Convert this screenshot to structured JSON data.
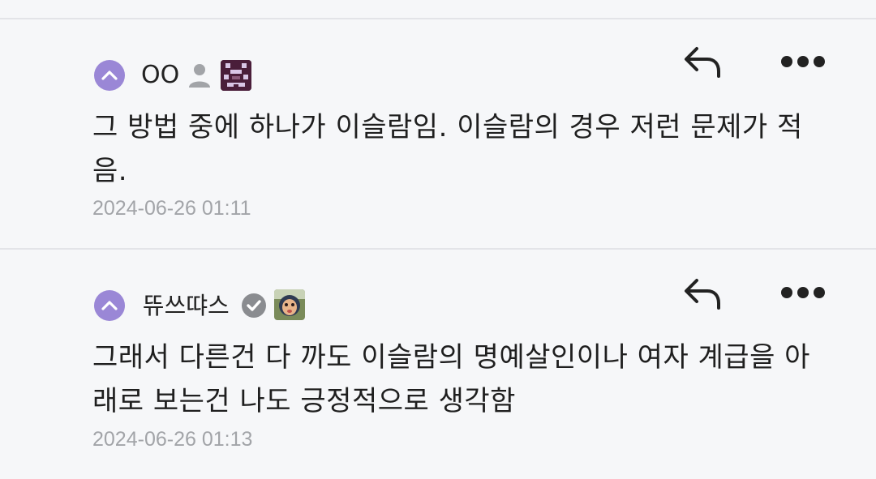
{
  "comments": [
    {
      "username": "OO",
      "body": "그 방법 중에 하나가 이슬람임. 이슬람의 경우 저런 문제가 적음.",
      "timestamp": "2024-06-26 01:11",
      "user_badge": "person-icon",
      "avatar_colors": {
        "bg": "#4a1e3a",
        "fg": "#d9c6e6"
      }
    },
    {
      "username": "뜌쓰땨스",
      "body": "그래서 다른건 다 까도 이슬람의 명예살인이나 여자 계급을 아래로 보는건 나도 긍정적으로 생각함",
      "timestamp": "2024-06-26 01:13",
      "user_badge": "verified-check-icon",
      "avatar_colors": {
        "bg": "#7a8b5a",
        "fg": "#e8b48a"
      }
    }
  ],
  "colors": {
    "background": "#f6f7f9",
    "upvote": "#9a87d6",
    "divider": "#e3e4e8",
    "timestamp": "#a2a4a8"
  }
}
